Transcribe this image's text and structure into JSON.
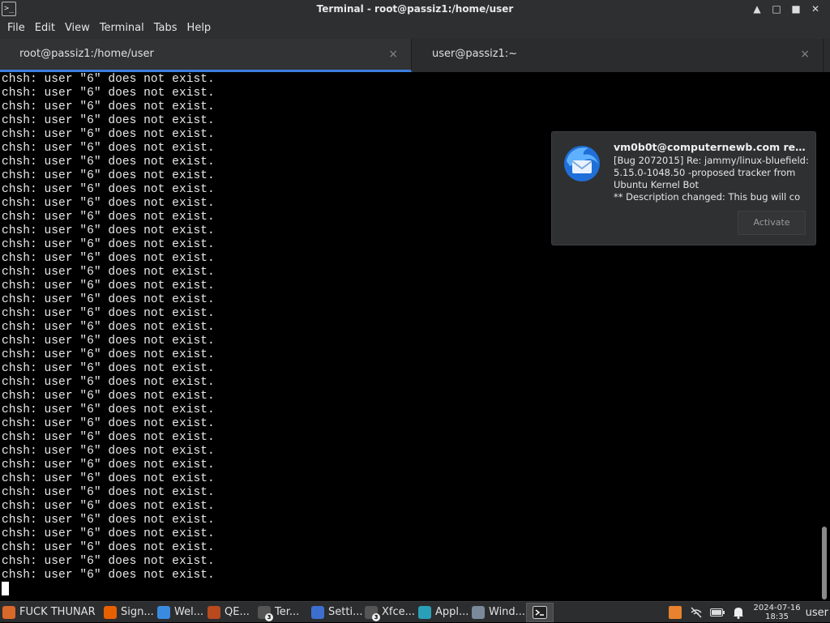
{
  "window": {
    "title": "Terminal - root@passiz1:/home/user",
    "icon_glyph": ">_",
    "buttons": {
      "up": "▲",
      "restore": "□",
      "maximize": "■",
      "close": "✕"
    }
  },
  "menu": [
    "File",
    "Edit",
    "View",
    "Terminal",
    "Tabs",
    "Help"
  ],
  "tabs": [
    {
      "label": "root@passiz1:/home/user",
      "active": true,
      "close": "×"
    },
    {
      "label": "user@passiz1:~",
      "active": false,
      "close": "×"
    }
  ],
  "terminal": {
    "line_text": "chsh: user \"6\" does not exist.",
    "line_count": 37
  },
  "notification": {
    "title": "vm0b0t@computernewb.com receiv...",
    "body": [
      "[Bug 2072015] Re: jammy/linux-bluefield:",
      "5.15.0-1048.50 -proposed tracker from",
      "Ubuntu Kernel Bot",
      "** Description changed: This bug will co"
    ],
    "action": "Activate",
    "icon": "thunderbird-icon"
  },
  "taskbar": {
    "tasks": [
      {
        "label": "FUCK THUNAR",
        "icon": "folder-icon",
        "color": "#d9682b",
        "width": 125
      },
      {
        "label": "Sign...",
        "icon": "firefox-icon",
        "color": "#e66000",
        "width": 66
      },
      {
        "label": "Wel...",
        "icon": "firefox-icon",
        "color": "#3a8be0",
        "width": 62
      },
      {
        "label": "QE...",
        "icon": "qemu-icon",
        "color": "#b84a1e",
        "width": 62
      },
      {
        "label": "Ter...",
        "icon": "terminal-icon",
        "color": "#555555",
        "badge": "3",
        "width": 66
      },
      {
        "label": "Setti...",
        "icon": "settings-icon",
        "color": "#3d6fd0",
        "width": 66
      },
      {
        "label": "Xfce...",
        "icon": "terminal-icon",
        "color": "#555555",
        "badge": "3",
        "width": 66
      },
      {
        "label": "Appl...",
        "icon": "apps-icon",
        "color": "#2aa0b8",
        "width": 66
      },
      {
        "label": "Wind...",
        "icon": "window-icon",
        "color": "#7a8a9a",
        "width": 70
      }
    ],
    "active_task_icon": "terminal-icon",
    "tray": {
      "clock_date": "2024-07-16",
      "clock_time": "18:35",
      "user": "user",
      "icons": [
        "app-tray-icon",
        "network-off-icon",
        "battery-icon",
        "bell-icon"
      ],
      "tray_color": "#e8822e"
    }
  }
}
